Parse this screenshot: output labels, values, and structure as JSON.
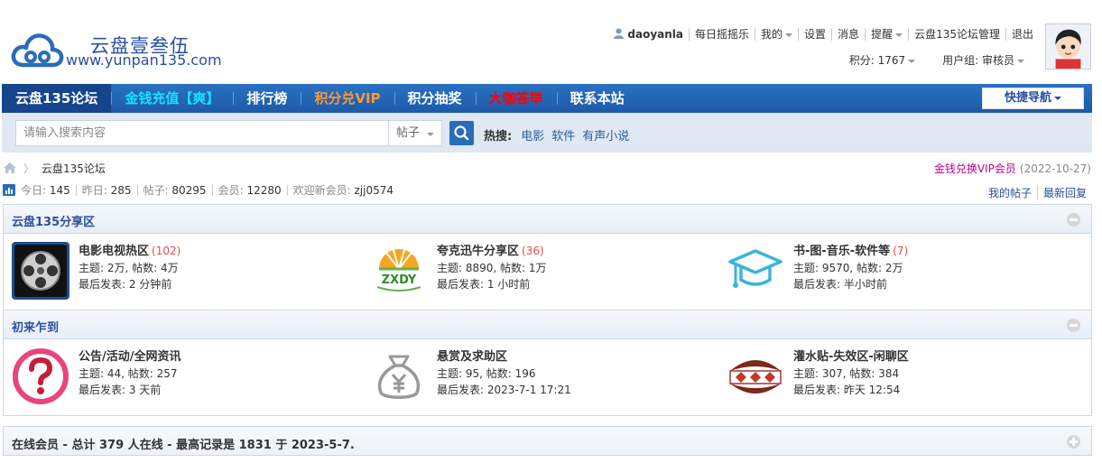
{
  "logo": {
    "title": "云盘壹叁伍",
    "url": "www.yunpan135.com"
  },
  "user": {
    "name": "daoyanla",
    "links": [
      "每日摇摇乐",
      "我的",
      "设置",
      "消息",
      "提醒",
      "云盘135论坛管理",
      "退出"
    ],
    "points_label": "积分: 1767",
    "group_label": "用户组: 审核员"
  },
  "nav": {
    "items": [
      {
        "label": "云盘135论坛",
        "color": "#ffffff"
      },
      {
        "label": "金钱充值【爽】",
        "color": "#19e0ff"
      },
      {
        "label": "排行榜",
        "color": "#ffffff"
      },
      {
        "label": "积分兑VIP",
        "color": "#ff9933"
      },
      {
        "label": "积分抽奖",
        "color": "#ffffff"
      },
      {
        "label": "大咖答举",
        "color": "#ff0000"
      },
      {
        "label": "联系本站",
        "color": "#ffffff"
      }
    ],
    "quick_nav": "快捷导航"
  },
  "search": {
    "placeholder": "请输入搜索内容",
    "type": "帖子",
    "hot_label": "热搜:",
    "hot_links": [
      "电影",
      "软件",
      "有声小说"
    ]
  },
  "breadcrumb": {
    "current": "云盘135论坛"
  },
  "notice": {
    "link": "金钱兑换VIP会员",
    "date": "(2022-10-27)"
  },
  "stats": {
    "today": "今日: ",
    "today_val": "145",
    "yesterday": "昨日: ",
    "yesterday_val": "285",
    "posts": "帖子: ",
    "posts_val": "80295",
    "members": "会员: ",
    "members_val": "12280",
    "newest": "欢迎新会员: ",
    "newest_val": "zjj0574",
    "links": [
      "我的帖子",
      "最新回复"
    ]
  },
  "blocks": [
    {
      "title": "云盘135分享区",
      "forums": [
        {
          "name": "电影电视热区",
          "new": "(102)",
          "meta": "主题: 2万, 帖数: 4万",
          "last": "最后发表: 2 分钟前",
          "icon": "film-reel-icon"
        },
        {
          "name": "夸克迅牛分享区",
          "new": "(36)",
          "meta": "主题: 8890, 帖数: 1万",
          "last": "最后发表: 1 小时前",
          "icon": "zxdy-logo-icon",
          "logo_text": "ZXDY"
        },
        {
          "name": "书-图-音乐-软件等",
          "new": "(7)",
          "meta": "主题: 9570, 帖数: 2万",
          "last": "最后发表: 半小时前",
          "icon": "graduation-cap-icon"
        }
      ]
    },
    {
      "title": "初来乍到",
      "forums": [
        {
          "name": "公告/活动/全网资讯",
          "new": "",
          "meta": "主题: 44, 帖数: 257",
          "last": "最后发表: 3 天前",
          "icon": "question-mark-icon"
        },
        {
          "name": "悬赏及求助区",
          "new": "",
          "meta": "主题: 95, 帖数: 196",
          "last": "最后发表: 2023-7-1 17:21",
          "icon": "money-bag-icon"
        },
        {
          "name": "灌水贴-失效区-闲聊区",
          "new": "",
          "meta": "主题: 307, 帖数: 384",
          "last": "最后发表: 昨天 12:54",
          "icon": "pattern-badge-icon"
        }
      ]
    }
  ],
  "online": {
    "title": "在线会员 - 总计 379 人在线 - 最高记录是 1831 于 2023-5-7."
  }
}
